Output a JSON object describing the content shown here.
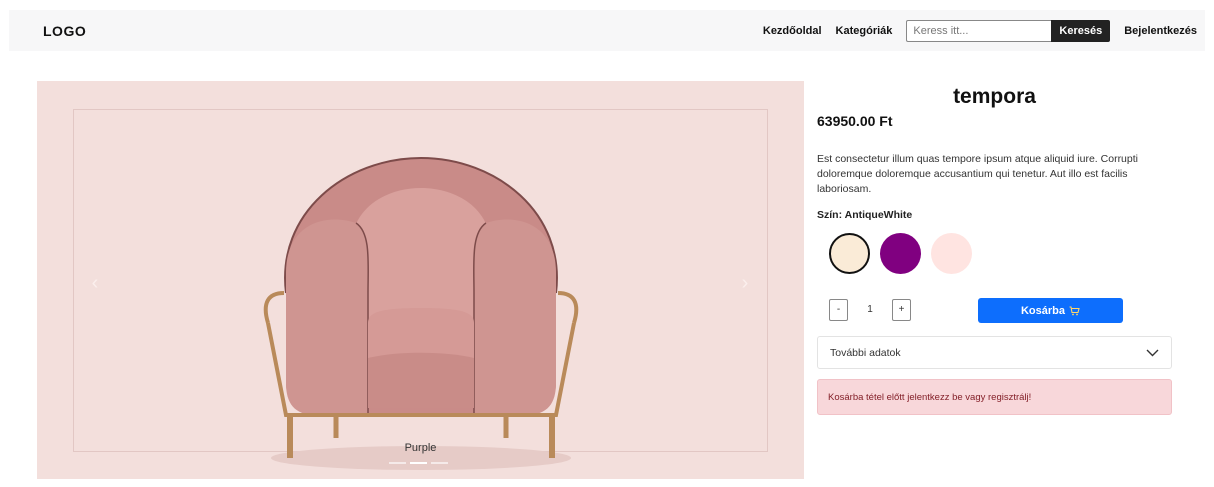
{
  "navbar": {
    "logo": "LOGO",
    "links": [
      "Kezdőoldal",
      "Kategóriák"
    ],
    "search_placeholder": "Keress itt...",
    "search_button": "Keresés",
    "login": "Bejelentkezés"
  },
  "carousel": {
    "caption": "Purple",
    "prev_glyph": "‹",
    "next_glyph": "›",
    "slide_count": 3,
    "active_slide": 2,
    "background_color": "#f3dfdc"
  },
  "product": {
    "title": "tempora",
    "price": "63950.00 Ft",
    "description": "Est consectetur illum quas tempore ipsum atque aliquid iure. Corrupti doloremque doloremque accusantium qui tenetur. Aut illo est facilis laboriosam.",
    "color_label": "Szín: AntiqueWhite",
    "swatches": [
      {
        "color": "#faebd7",
        "selected": true
      },
      {
        "color": "#800080",
        "selected": false
      },
      {
        "color": "#ffe4e1",
        "selected": false
      }
    ],
    "quantity": {
      "minus": "-",
      "value": "1",
      "plus": "+"
    },
    "cart_button": "Kosárba",
    "cart_icon": "cart-icon",
    "accordion_label": "További adatok",
    "alert": "Kosárba tétel előtt jelentkezz be vagy regisztrálj!"
  },
  "colors": {
    "primary": "#0d6efd",
    "alert_bg": "#f8d7da",
    "alert_text": "#842029",
    "navbar_bg": "#f7f7f8"
  }
}
